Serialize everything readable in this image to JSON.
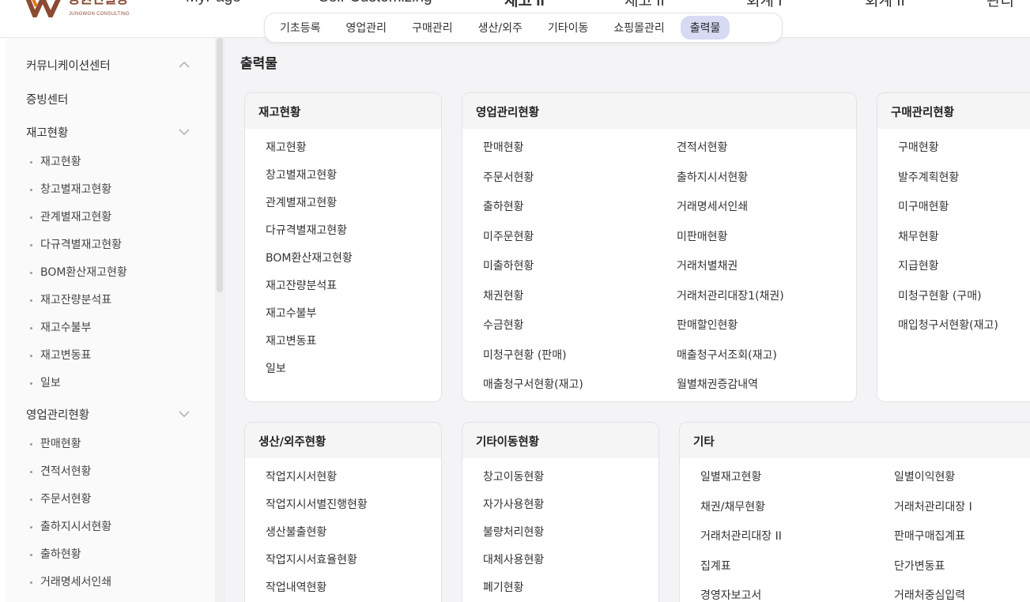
{
  "header": {
    "logo_text": "중원컨설팅",
    "logo_sub": "JUNGWON CONSULTING",
    "top_menu": [
      "MyPage",
      "Self-Customizing",
      "재고 II",
      "재고 II",
      "회계 I",
      "회계 II",
      "관리"
    ]
  },
  "subnav": {
    "items": [
      "기초등록",
      "영업관리",
      "구매관리",
      "생산/외주",
      "기타이동",
      "쇼핑몰관리",
      "출력물"
    ],
    "active_index": 6
  },
  "sidebar": {
    "sections": [
      {
        "label": "커뮤니케이션센터",
        "chevron": "chevron-up-icon"
      },
      {
        "label": "증빙센터"
      },
      {
        "label": "재고현황",
        "chevron": "chevron-down-icon",
        "items": [
          "재고현황",
          "창고별재고현황",
          "관계별재고현황",
          "다규격별재고현황",
          "BOM환산재고현황",
          "재고잔량분석표",
          "재고수불부",
          "재고변동표",
          "일보"
        ]
      },
      {
        "label": "영업관리현황",
        "chevron": "chevron-down-icon",
        "items": [
          "판매현황",
          "견적서현황",
          "주문서현황",
          "출하지시서현황",
          "출하현황",
          "거래명세서인쇄"
        ]
      }
    ]
  },
  "main": {
    "title": "출력물",
    "cards": [
      {
        "title": "재고현황",
        "col1": [
          "재고현황",
          "창고별재고현황",
          "관계별재고현황",
          "다규격별재고현황",
          "BOM환산재고현황",
          "재고잔량분석표",
          "재고수불부",
          "재고변동표",
          "일보"
        ],
        "col2": []
      },
      {
        "title": "영업관리현황",
        "col1": [
          "판매현황",
          "주문서현황",
          "출하현황",
          "미주문현황",
          "미출하현황",
          "채권현황",
          "수금현황",
          "미청구현황 (판매)",
          "매출청구서현황(재고)"
        ],
        "col2": [
          "견적서현황",
          "출하지시서현황",
          "거래명세서인쇄",
          "미판매현황",
          "거래처별채권",
          "거래처관리대장1(채권)",
          "판매할인현황",
          "매출청구서조회(재고)",
          "월별채권증감내역"
        ]
      },
      {
        "title": "구매관리현황",
        "col1": [
          "구매현황",
          "발주계획현황",
          "미구매현황",
          "채무현황",
          "지급현황",
          "미청구현황 (구매)",
          "매입청구서현황(재고)"
        ],
        "col2": []
      },
      {
        "title": "생산/외주현황",
        "col1": [
          "작업지시서현황",
          "작업지시서별진행현황",
          "생산불출현황",
          "작업지시서효율현황",
          "작업내역현황"
        ],
        "col2": []
      },
      {
        "title": "기타이동현황",
        "col1": [
          "창고이동현황",
          "자가사용현황",
          "불량처리현황",
          "대체사용현황",
          "폐기현황"
        ],
        "col2": []
      },
      {
        "title": "기타",
        "col1": [
          "일별재고현황",
          "채권/채무현황",
          "거래처관리대장 II",
          "집계표",
          "경영자보고서"
        ],
        "col2": [
          "일별이익현황",
          "거래처관리대장 I",
          "판매구매집계표",
          "단가변동표",
          "거래처중심입력"
        ]
      }
    ]
  },
  "colors": {
    "accent_pill": "#d6daf3",
    "logo_brown": "#8a4b32",
    "logo_orange": "#e0771f"
  }
}
